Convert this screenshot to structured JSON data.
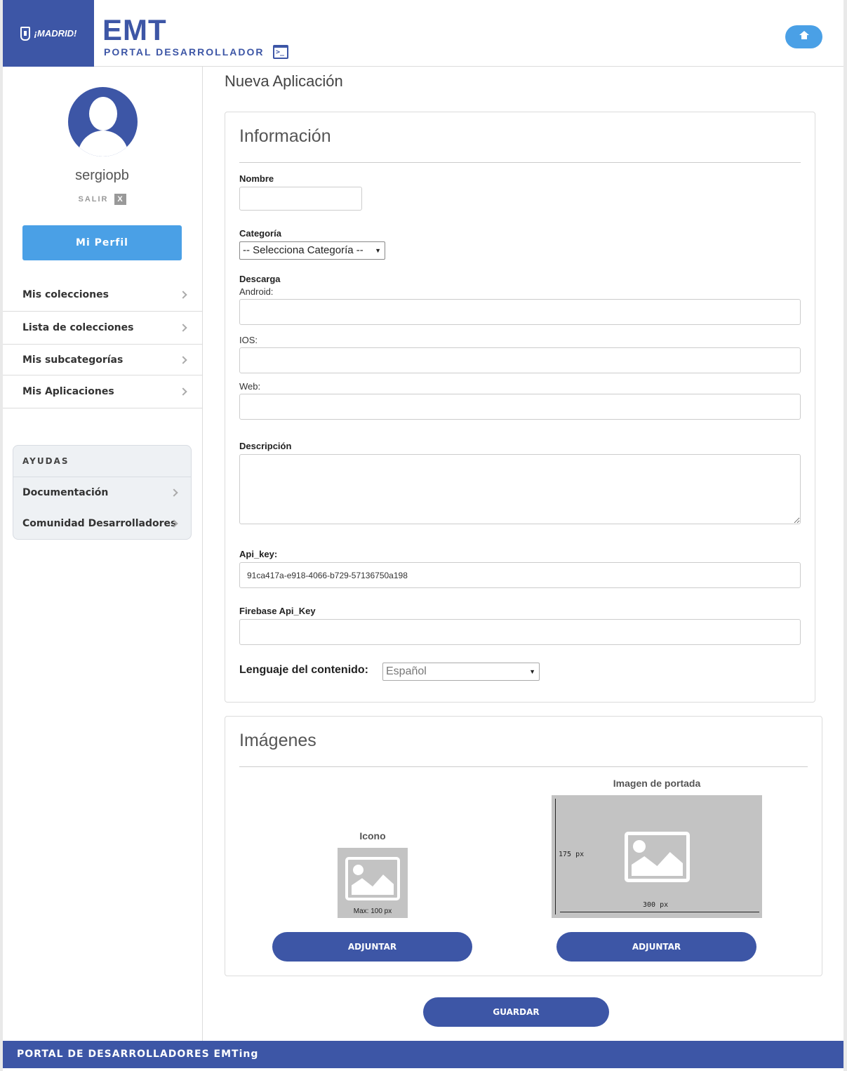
{
  "header": {
    "madrid_logo_text": "¡MADRID!",
    "brand_title": "EMT",
    "brand_subtitle": "PORTAL DESARROLLADOR",
    "console_glyph": ">_",
    "icons": {
      "console": "terminal-icon",
      "home": "home-icon"
    }
  },
  "sidebar": {
    "username": "sergiopb",
    "logout_label": "SALIR",
    "logout_x": "X",
    "profile_button": "Mi Perfil",
    "nav": [
      {
        "label": "Mis colecciones"
      },
      {
        "label": "Lista de colecciones"
      },
      {
        "label": "Mis subcategorías"
      },
      {
        "label": "Mis Aplicaciones"
      }
    ],
    "help": {
      "title": "AYUDAS",
      "items": [
        {
          "label": "Documentación"
        },
        {
          "label": "Comunidad Desarrolladores"
        }
      ]
    }
  },
  "main": {
    "page_title": "Nueva Aplicación",
    "info": {
      "heading": "Información",
      "name_label": "Nombre",
      "name_value": "",
      "category_label": "Categoría",
      "category_selected": "-- Selecciona Categoría --",
      "download_label": "Descarga",
      "android_label": "Android:",
      "android_value": "",
      "ios_label": "IOS:",
      "ios_value": "",
      "web_label": "Web:",
      "web_value": "",
      "description_label": "Descripción",
      "description_value": "",
      "apikey_label": "Api_key:",
      "apikey_value": "91ca417a-e918-4066-b729-57136750a198",
      "firebase_label": "Firebase Api_Key",
      "firebase_value": "",
      "language_label": "Lenguaje del contenido:",
      "language_selected": "Español"
    },
    "images": {
      "heading": "Imágenes",
      "icon_label": "Icono",
      "icon_caption": "Max: 100 px",
      "cover_label": "Imagen de portada",
      "cover_height": "175 px",
      "cover_width": "300 px",
      "attach_icon_button": "ADJUNTAR",
      "attach_cover_button": "ADJUNTAR"
    },
    "save_button": "GUARDAR"
  },
  "footer": {
    "text": "PORTAL DE DESARROLLADORES EMTing"
  },
  "colors": {
    "brand": "#3d56a6",
    "accent": "#4aa0e6",
    "placeholder": "#c3c3c3"
  }
}
